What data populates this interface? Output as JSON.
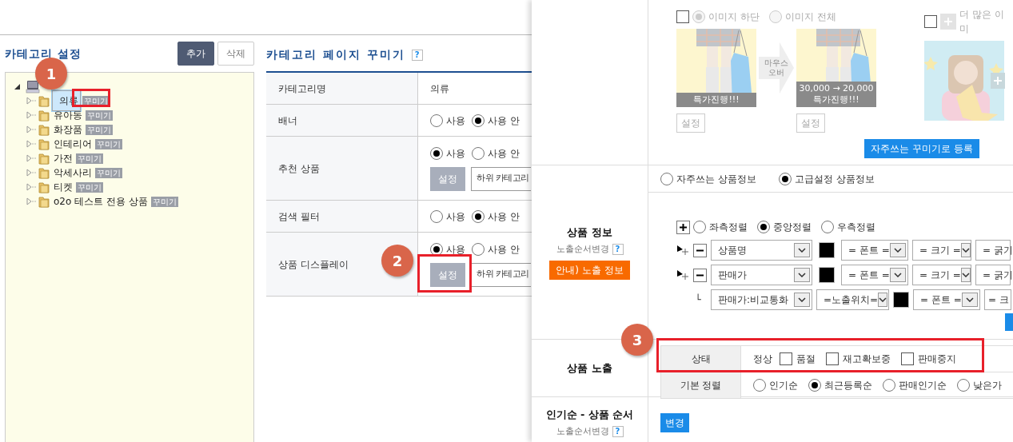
{
  "category_panel": {
    "title": "카테고리 설정",
    "buttons": [
      {
        "label": "추가",
        "kind": "primary"
      },
      {
        "label": "삭제",
        "kind": "secondary"
      }
    ],
    "tree": {
      "expanded": true,
      "children": [
        {
          "label": "의류",
          "tag": "꾸미기",
          "selected": true
        },
        {
          "label": "유아동",
          "tag": "꾸미기",
          "selected": false
        },
        {
          "label": "화장품",
          "tag": "꾸미기",
          "selected": false
        },
        {
          "label": "인테리어",
          "tag": "꾸미기",
          "selected": false
        },
        {
          "label": "가전",
          "tag": "꾸미기",
          "selected": false
        },
        {
          "label": "악세사리",
          "tag": "꾸미기",
          "selected": false
        },
        {
          "label": "티켓",
          "tag": "꾸미기",
          "selected": false
        },
        {
          "label": "o2o 테스트 전용 상품",
          "tag": "꾸미기",
          "selected": false
        }
      ]
    }
  },
  "decorate_panel": {
    "title": "카테고리 페이지 꾸미기",
    "help": "?",
    "rows": [
      {
        "kind": "text",
        "label": "카테고리명",
        "value": "의류"
      },
      {
        "kind": "radio",
        "label": "배너",
        "options": [
          {
            "label": "사용",
            "selected": false
          },
          {
            "label": "사용 안",
            "selected": true
          }
        ]
      },
      {
        "kind": "radio_setting",
        "label": "추천 상품",
        "options": [
          {
            "label": "사용",
            "selected": true
          },
          {
            "label": "사용 안",
            "selected": false
          }
        ],
        "button": "설정",
        "field": "하위 카테고리"
      },
      {
        "kind": "radio",
        "label": "검색 필터",
        "options": [
          {
            "label": "사용",
            "selected": false
          },
          {
            "label": "사용 안",
            "selected": true
          }
        ]
      },
      {
        "kind": "radio_setting",
        "label": "상품 디스플레이",
        "options": [
          {
            "label": "사용",
            "selected": true
          },
          {
            "label": "사용 안",
            "selected": false
          }
        ],
        "button": "설정",
        "field": "하위 카테고리"
      }
    ]
  },
  "settings_panel": {
    "image_style": {
      "disabled": true,
      "checked": false,
      "positions": [
        {
          "label": "이미지 하단",
          "selected": true
        },
        {
          "label": "이미지 전체",
          "selected": false
        }
      ],
      "previews": [
        {
          "captions": [
            "특가진행!!!"
          ],
          "button": "설정"
        },
        {
          "captions": [
            "30,000 → 20,000",
            "특가진행!!!"
          ],
          "button": "설정"
        }
      ],
      "hover_label": "마우스 오버",
      "more": {
        "checked": false,
        "label": "더 많은 이미"
      },
      "register_button": "자주쓰는 꾸미기로 등록"
    },
    "product_info": {
      "label": "상품 정보",
      "sublabel": "노출순서변경",
      "help": "?",
      "guide_button": "안내) 노출 정보",
      "modes": [
        {
          "label": "자주쓰는 상품정보",
          "selected": false
        },
        {
          "label": "고급설정 상품정보",
          "selected": true
        }
      ],
      "alignments": [
        {
          "label": "좌측정렬",
          "selected": false
        },
        {
          "label": "중앙정렬",
          "selected": true
        },
        {
          "label": "우측정렬",
          "selected": false
        }
      ],
      "fields": [
        {
          "kind": "main",
          "name": "상품명",
          "color": "#000000",
          "selects": [
            "= 폰트 =",
            "= 크기 =",
            "= 굵기"
          ]
        },
        {
          "kind": "main",
          "name": "판매가",
          "color": "#000000",
          "selects": [
            "= 폰트 =",
            "= 크기 =",
            "= 굵기"
          ]
        },
        {
          "kind": "sub",
          "branch": "└",
          "name": "판매가:비교통화",
          "position": "=노출위치=",
          "color": "#000000",
          "selects": [
            "= 폰트 =",
            "= 크"
          ]
        }
      ]
    },
    "product_exposure": {
      "label": "상품 노출",
      "status": {
        "label": "상태",
        "normal": "정상",
        "options": [
          {
            "label": "품절",
            "checked": false
          },
          {
            "label": "재고확보중",
            "checked": false
          },
          {
            "label": "판매중지",
            "checked": false
          }
        ]
      },
      "sort": {
        "label": "기본 정렬",
        "options": [
          {
            "label": "인기순",
            "selected": false
          },
          {
            "label": "최근등록순",
            "selected": true
          },
          {
            "label": "판매인기순",
            "selected": false
          },
          {
            "label": "낮은가",
            "selected": false
          }
        ]
      }
    },
    "popular_order": {
      "label": "인기순 - 상품 순서",
      "sublabel": "노출순서변경",
      "help": "?",
      "button": "변경"
    }
  },
  "annotations": [
    {
      "label": "1"
    },
    {
      "label": "2"
    },
    {
      "label": "3"
    }
  ]
}
